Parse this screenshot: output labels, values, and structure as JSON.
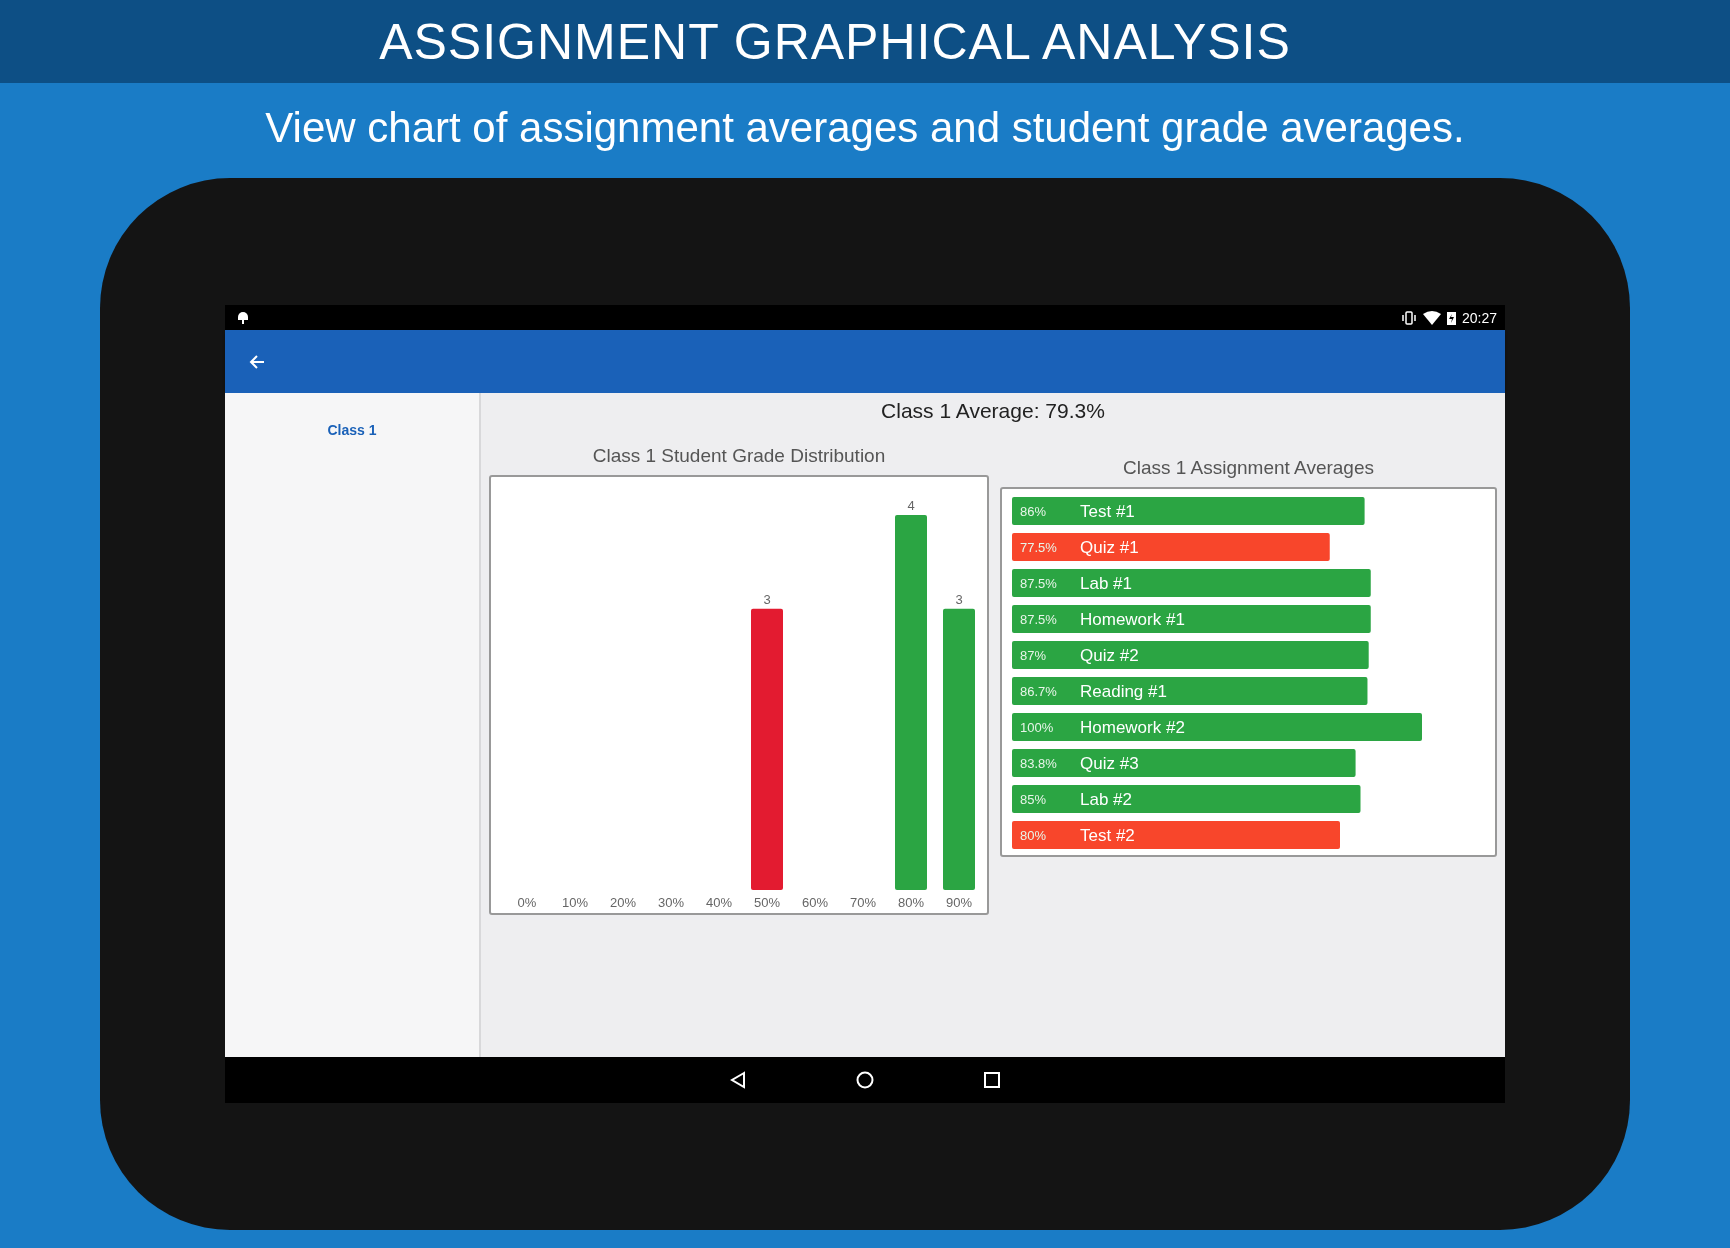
{
  "banner": {
    "title": "ASSIGNMENT GRAPHICAL ANALYSIS",
    "subtitle": "View chart of assignment averages and student grade averages."
  },
  "status_bar": {
    "time": "20:27"
  },
  "sidebar": {
    "items": [
      {
        "label": "Class 1",
        "selected": true
      }
    ]
  },
  "class_average": "Class 1 Average: 79.3%",
  "distribution": {
    "title": "Class 1 Student Grade Distribution",
    "chart_data": {
      "type": "bar",
      "categories": [
        "0%",
        "10%",
        "20%",
        "30%",
        "40%",
        "50%",
        "60%",
        "70%",
        "80%",
        "90%"
      ],
      "series": [
        {
          "color": "#e31b30",
          "values": [
            null,
            null,
            null,
            null,
            null,
            3,
            null,
            null,
            null,
            null
          ],
          "value_labels": [
            null,
            null,
            null,
            null,
            null,
            "3",
            null,
            null,
            null,
            null
          ]
        },
        {
          "color": "#2ba543",
          "values": [
            null,
            null,
            null,
            null,
            null,
            null,
            null,
            null,
            4,
            3
          ],
          "value_labels": [
            null,
            null,
            null,
            null,
            null,
            null,
            null,
            null,
            "4",
            "3"
          ]
        }
      ]
    }
  },
  "averages": {
    "title": "Class 1 Assignment Averages",
    "chart_data": {
      "type": "bar",
      "orientation": "horizontal",
      "categories": [
        "Test #1",
        "Quiz #1",
        "Lab #1",
        "Homework #1",
        "Quiz #2",
        "Reading #1",
        "Homework #2",
        "Quiz #3",
        "Lab #2",
        "Test #2"
      ],
      "series": [
        {
          "color": "#f8462b",
          "values": [
            null,
            77.5,
            null,
            null,
            null,
            null,
            null,
            null,
            null,
            80
          ],
          "value_labels": [
            null,
            "77.5%",
            null,
            null,
            null,
            null,
            null,
            null,
            null,
            "80%"
          ]
        },
        {
          "color": "#2ba543",
          "values": [
            86,
            null,
            87.5,
            87.5,
            87,
            86.7,
            100,
            83.8,
            85,
            null
          ],
          "value_labels": [
            "86%",
            null,
            "87.5%",
            "87.5%",
            "87%",
            "86.7%",
            "100%",
            "83.8%",
            "85%",
            null
          ]
        }
      ]
    }
  }
}
